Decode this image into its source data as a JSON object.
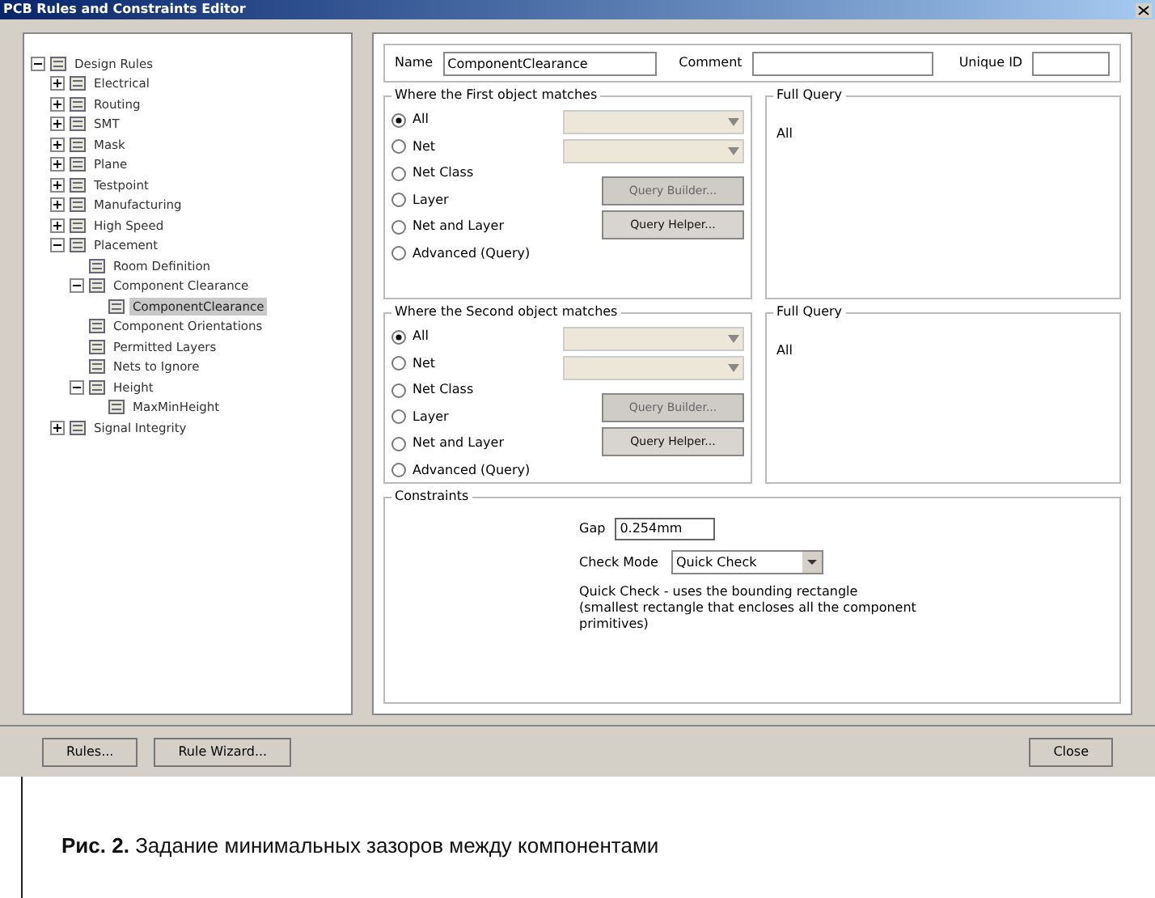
{
  "window": {
    "title": "PCB Rules and Constraints Editor"
  },
  "tree": [
    {
      "label": "Design Rules",
      "expanded": true,
      "selected": false,
      "children": [
        {
          "label": "Electrical",
          "expanded": false,
          "selected": false
        },
        {
          "label": "Routing",
          "expanded": false,
          "selected": false
        },
        {
          "label": "SMT",
          "expanded": false,
          "selected": false
        },
        {
          "label": "Mask",
          "expanded": false,
          "selected": false
        },
        {
          "label": "Plane",
          "expanded": false,
          "selected": false
        },
        {
          "label": "Testpoint",
          "expanded": false,
          "selected": false
        },
        {
          "label": "Manufacturing",
          "expanded": false,
          "selected": false
        },
        {
          "label": "High Speed",
          "expanded": false,
          "selected": false
        },
        {
          "label": "Placement",
          "expanded": true,
          "selected": false,
          "children": [
            {
              "label": "Room Definition",
              "selected": false
            },
            {
              "label": "Component Clearance",
              "expanded": true,
              "selected": false,
              "children": [
                {
                  "label": "ComponentClearance",
                  "selected": true
                }
              ]
            },
            {
              "label": "Component Orientations",
              "selected": false
            },
            {
              "label": "Permitted Layers",
              "selected": false
            },
            {
              "label": "Nets to Ignore",
              "selected": false
            },
            {
              "label": "Height",
              "expanded": true,
              "selected": false,
              "children": [
                {
                  "label": "MaxMinHeight",
                  "selected": false
                }
              ]
            }
          ]
        },
        {
          "label": "Signal Integrity",
          "expanded": false,
          "selected": false
        }
      ]
    }
  ],
  "rule": {
    "name_label": "Name",
    "name": "ComponentClearance",
    "comment_label": "Comment",
    "unique_id_label": "Unique ID"
  },
  "scopes": [
    {
      "title": "Where the First object matches",
      "options": [
        {
          "label": "All",
          "selected": true
        },
        {
          "label": "Net",
          "selected": false
        },
        {
          "label": "Net Class",
          "selected": false
        },
        {
          "label": "Layer",
          "selected": false
        },
        {
          "label": "Net and Layer",
          "selected": false
        },
        {
          "label": "Advanced (Query)",
          "selected": false
        }
      ],
      "buttons": [
        {
          "label": "Query Builder...",
          "disabled": true
        },
        {
          "label": "Query Helper...",
          "disabled": false
        }
      ],
      "query_title": "Full Query",
      "query": "All"
    },
    {
      "title": "Where the Second object matches",
      "options": [
        {
          "label": "All",
          "selected": true
        },
        {
          "label": "Net",
          "selected": false
        },
        {
          "label": "Net Class",
          "selected": false
        },
        {
          "label": "Layer",
          "selected": false
        },
        {
          "label": "Net and Layer",
          "selected": false
        },
        {
          "label": "Advanced (Query)",
          "selected": false
        }
      ],
      "buttons": [
        {
          "label": "Query Builder...",
          "disabled": true
        },
        {
          "label": "Query Helper...",
          "disabled": false
        }
      ],
      "query_title": "Full Query",
      "query": "All"
    }
  ],
  "constraints": {
    "title": "Constraints",
    "gap_label": "Gap",
    "gap": "0.254mm",
    "mode_label": "Check Mode",
    "mode": "Quick Check",
    "note": "Quick Check - uses the bounding rectangle (smallest rectangle that encloses all the component primitives)"
  },
  "footer": {
    "left_buttons": [
      "Rules...",
      "Rule Wizard..."
    ],
    "right_buttons": [
      "Close"
    ]
  },
  "caption": "**Рис. 2.** Задание минимальных зазоров между компонентами"
}
